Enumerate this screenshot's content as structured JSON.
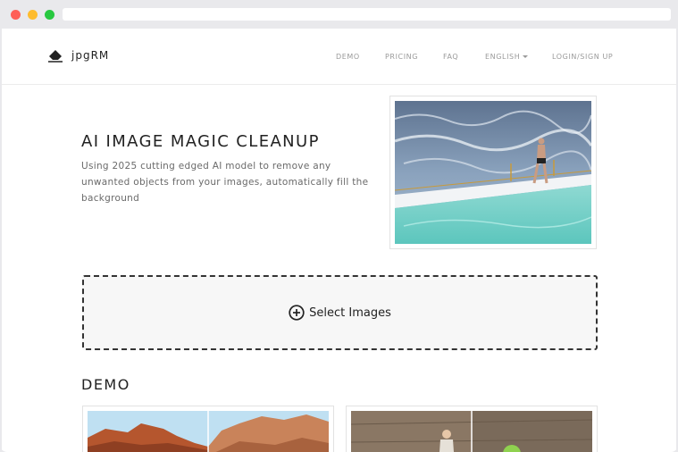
{
  "brand": {
    "name": "jpgRM"
  },
  "nav": {
    "links": [
      {
        "label": "DEMO"
      },
      {
        "label": "PRICING"
      },
      {
        "label": "FAQ"
      },
      {
        "label": "ENGLISH",
        "has_dropdown": true
      },
      {
        "label": "LOGIN/SIGN UP"
      }
    ]
  },
  "hero": {
    "title": "AI IMAGE MAGIC CLEANUP",
    "description": "Using 2025 cutting edged AI model to remove any unwanted objects from your images, automatically fill the background"
  },
  "upload": {
    "label": "Select Images",
    "icon": "plus-circle-icon"
  },
  "demo": {
    "heading": "DEMO"
  },
  "colors": {
    "dashed_border": "#333333",
    "text_dark": "#222222",
    "nav_text": "#9a9a9a"
  }
}
